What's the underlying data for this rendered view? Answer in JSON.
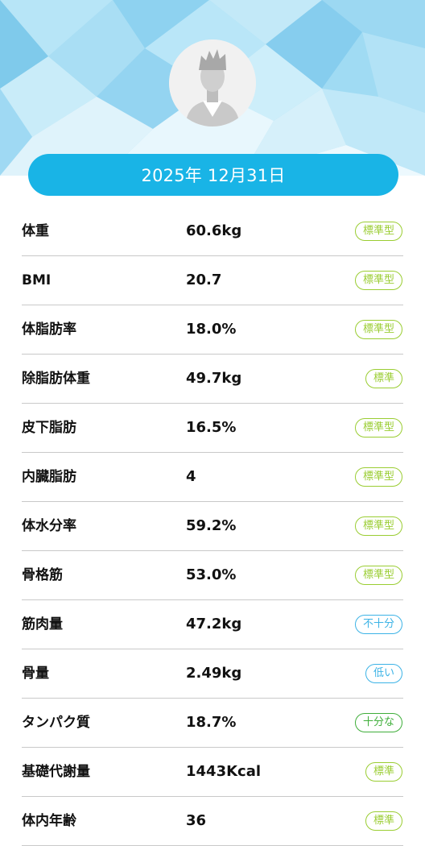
{
  "header": {
    "date": "2025年 12月31日",
    "avatar_icon": "user-avatar-icon"
  },
  "colors": {
    "date_pill": "#19b4e6",
    "badge_standard": "#9acd32",
    "badge_insufficient": "#3cb3e6",
    "badge_sufficient": "#3fae3a"
  },
  "metrics": [
    {
      "label": "体重",
      "value": "60.6kg",
      "status": "標準型",
      "status_type": "standard"
    },
    {
      "label": "BMI",
      "value": "20.7",
      "status": "標準型",
      "status_type": "standard"
    },
    {
      "label": "体脂肪率",
      "value": "18.0%",
      "status": "標準型",
      "status_type": "standard"
    },
    {
      "label": "除脂肪体重",
      "value": "49.7kg",
      "status": "標準",
      "status_type": "standard"
    },
    {
      "label": "皮下脂肪",
      "value": "16.5%",
      "status": "標準型",
      "status_type": "standard"
    },
    {
      "label": "内臓脂肪",
      "value": "4",
      "status": "標準型",
      "status_type": "standard"
    },
    {
      "label": "体水分率",
      "value": "59.2%",
      "status": "標準型",
      "status_type": "standard"
    },
    {
      "label": "骨格筋",
      "value": "53.0%",
      "status": "標準型",
      "status_type": "standard"
    },
    {
      "label": "筋肉量",
      "value": "47.2kg",
      "status": "不十分",
      "status_type": "insufficient"
    },
    {
      "label": "骨量",
      "value": "2.49kg",
      "status": "低い",
      "status_type": "insufficient"
    },
    {
      "label": "タンパク質",
      "value": "18.7%",
      "status": "十分な",
      "status_type": "sufficient"
    },
    {
      "label": "基礎代謝量",
      "value": "1443Kcal",
      "status": "標準",
      "status_type": "standard"
    },
    {
      "label": "体内年齢",
      "value": "36",
      "status": "標準",
      "status_type": "standard"
    }
  ]
}
